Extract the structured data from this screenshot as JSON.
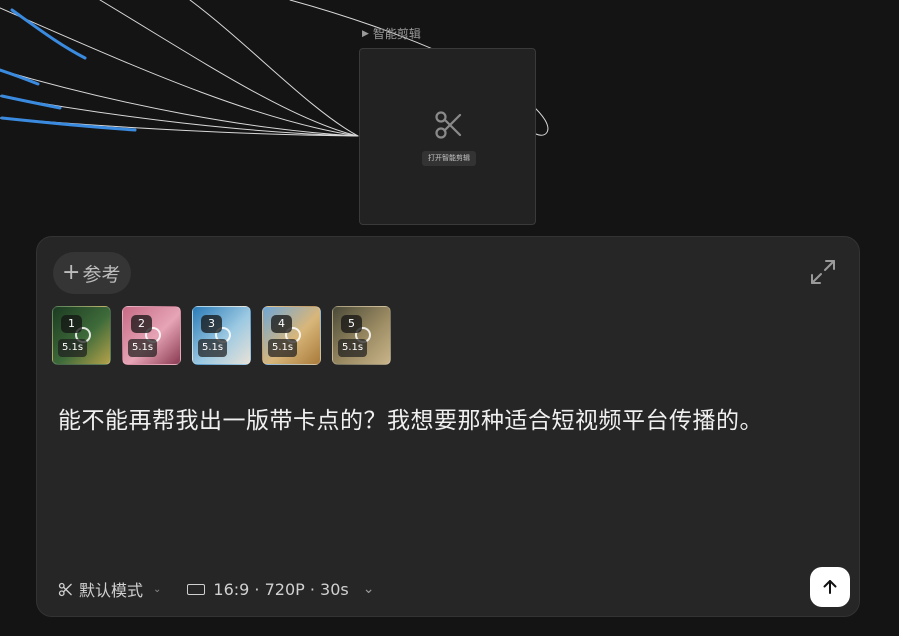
{
  "node": {
    "title": "智能剪辑",
    "open_label": "打开智能剪辑",
    "icon": "scissors-icon"
  },
  "panel": {
    "ref_button": {
      "icon": "plus-icon",
      "label": "参考"
    },
    "expand_icon": "expand-icon",
    "clips": [
      {
        "index": "1",
        "duration": "5.1s",
        "colors": [
          "#1c3b22",
          "#3e6b3a",
          "#b6a24a"
        ]
      },
      {
        "index": "2",
        "duration": "5.1s",
        "colors": [
          "#c76a86",
          "#e6a4b6",
          "#8a3a52"
        ]
      },
      {
        "index": "3",
        "duration": "5.1s",
        "colors": [
          "#2a7bb8",
          "#9cc9e2",
          "#e8e2d8"
        ]
      },
      {
        "index": "4",
        "duration": "5.1s",
        "colors": [
          "#6fa6d6",
          "#d8b67a",
          "#a87a3a"
        ]
      },
      {
        "index": "5",
        "duration": "5.1s",
        "colors": [
          "#4a4a38",
          "#9a8a62",
          "#c9b48a"
        ]
      }
    ],
    "prompt": "能不能再帮我出一版带卡点的？我想要那种适合短视频平台传播的。",
    "mode": {
      "icon": "scissors-icon",
      "label": "默认模式"
    },
    "settings": {
      "icon": "aspect-ratio-icon",
      "label": "16:9 · 720P · 30s"
    },
    "send_icon": "arrow-up-icon"
  },
  "colors": {
    "background": "#141414",
    "panel": "#262626",
    "accent_line": "#2f7fd6"
  }
}
